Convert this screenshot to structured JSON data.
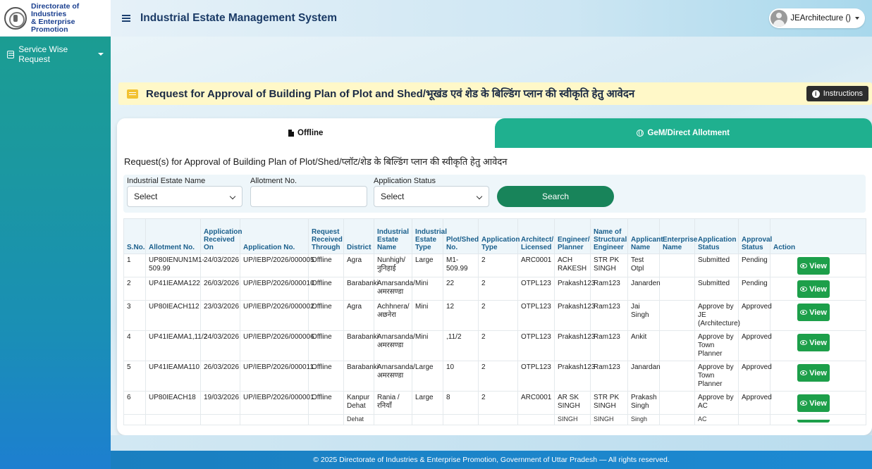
{
  "brand": {
    "line1": "Directorate of Industries",
    "line2": "& Enterprise Promotion"
  },
  "header": {
    "title": "Industrial Estate Management System",
    "user": "JEArchitecture ()"
  },
  "sidebar": {
    "items": [
      {
        "label": "Service Wise Request"
      }
    ]
  },
  "banner": {
    "title": "Request for Approval of Building Plan of Plot and Shed/भूखंड एवं शेड के बिल्डिंग प्लान की स्वीकृति हेतु आवेदन",
    "instructions_label": "Instructions"
  },
  "tabs": [
    {
      "label": "Offline",
      "active": true
    },
    {
      "label": "GeM/Direct Allotment",
      "active": false
    }
  ],
  "section_title": "Request(s) for Approval of Building Plan of Plot/Shed/प्लॉट/शेड के बिल्डिंग प्लान की स्वीकृति हेतु आवेदन",
  "filters": {
    "estate_label": "Industrial Estate Name",
    "estate_value": "Select",
    "allotment_label": "Allotment No.",
    "allotment_value": "",
    "status_label": "Application Status",
    "status_value": "Select",
    "search_label": "Search"
  },
  "table": {
    "headers": [
      "S.No.",
      "Allotment No.",
      "Application Received On",
      "Application No.",
      "Request Received Through",
      "District",
      "Industrial Estate Name",
      "Industrial Estate Type",
      "Plot/Shed No.",
      "Application Type",
      "Architect/ Licensed",
      "Engineer/ Planner",
      "Name of Structural Engineer",
      "Applicant Name",
      "Enterprise Name",
      "Application Status",
      "Approval Status",
      "Action"
    ],
    "view_label": "View",
    "rows": [
      [
        "1",
        "UP80IENUN1M1-509.99",
        "24/03/2026",
        "UP/IEBP/2026/000005",
        "Offline",
        "Agra",
        "Nunhigh/ नुनिहाई",
        "Large",
        "M1-509.99",
        "2",
        "ARC0001",
        "ACH RAKESH",
        "STR PK SINGH",
        "Test Otpl",
        "",
        "Submitted",
        "Pending"
      ],
      [
        "2",
        "UP41IEAMA122",
        "26/03/2026",
        "UP/IEBP/2026/000010",
        "Offline",
        "Barabanki",
        "Amarsanda/ अमरसण्डा",
        "Mini",
        "22",
        "2",
        "OTPL123",
        "Prakash123",
        "Ram123",
        "Janarden",
        "",
        "Submitted",
        "Pending"
      ],
      [
        "3",
        "UP80IEACH112",
        "23/03/2026",
        "UP/IEBP/2026/000002",
        "Offline",
        "Agra",
        "Achhnera/ अछनेरा",
        "Mini",
        "12",
        "2",
        "OTPL123",
        "Prakash123",
        "Ram123",
        "Jai Singh",
        "",
        "Approve by JE (Architecture)",
        "Approved"
      ],
      [
        "4",
        "UP41IEAMA1,11/2",
        "24/03/2026",
        "UP/IEBP/2026/000006",
        "Offline",
        "Barabanki",
        "Amarsanda/ अमरसण्डा",
        "Mini",
        ",11/2",
        "2",
        "OTPL123",
        "Prakash123",
        "Ram123",
        "Ankit",
        "",
        "Approve by Town Planner",
        "Approved"
      ],
      [
        "5",
        "UP41IEAMA110",
        "26/03/2026",
        "UP/IEBP/2026/000011",
        "Offline",
        "Barabanki",
        "Amarsanda/ अमरसण्डा",
        "Large",
        "10",
        "2",
        "OTPL123",
        "Prakash123",
        "Ram123",
        "Janardan",
        "",
        "Approve by Town Planner",
        "Approved"
      ],
      [
        "6",
        "UP80IEACH18",
        "19/03/2026",
        "UP/IEBP/2026/000001",
        "Offline",
        "Kanpur Dehat",
        "Rania /रनियाँ",
        "Large",
        "8",
        "2",
        "ARC0001",
        "AR SK SINGH",
        "STR PK SINGH",
        "Prakash Singh",
        "",
        "Approve by AC",
        "Approved"
      ]
    ],
    "ghost_row": [
      "Dehat",
      "SINGH",
      "SINGH",
      "Singh",
      "AC"
    ]
  },
  "footer": {
    "text": "© 2025 Directorate of Industries & Enterprise Promotion, Government of Uttar Pradesh — All rights reserved."
  }
}
